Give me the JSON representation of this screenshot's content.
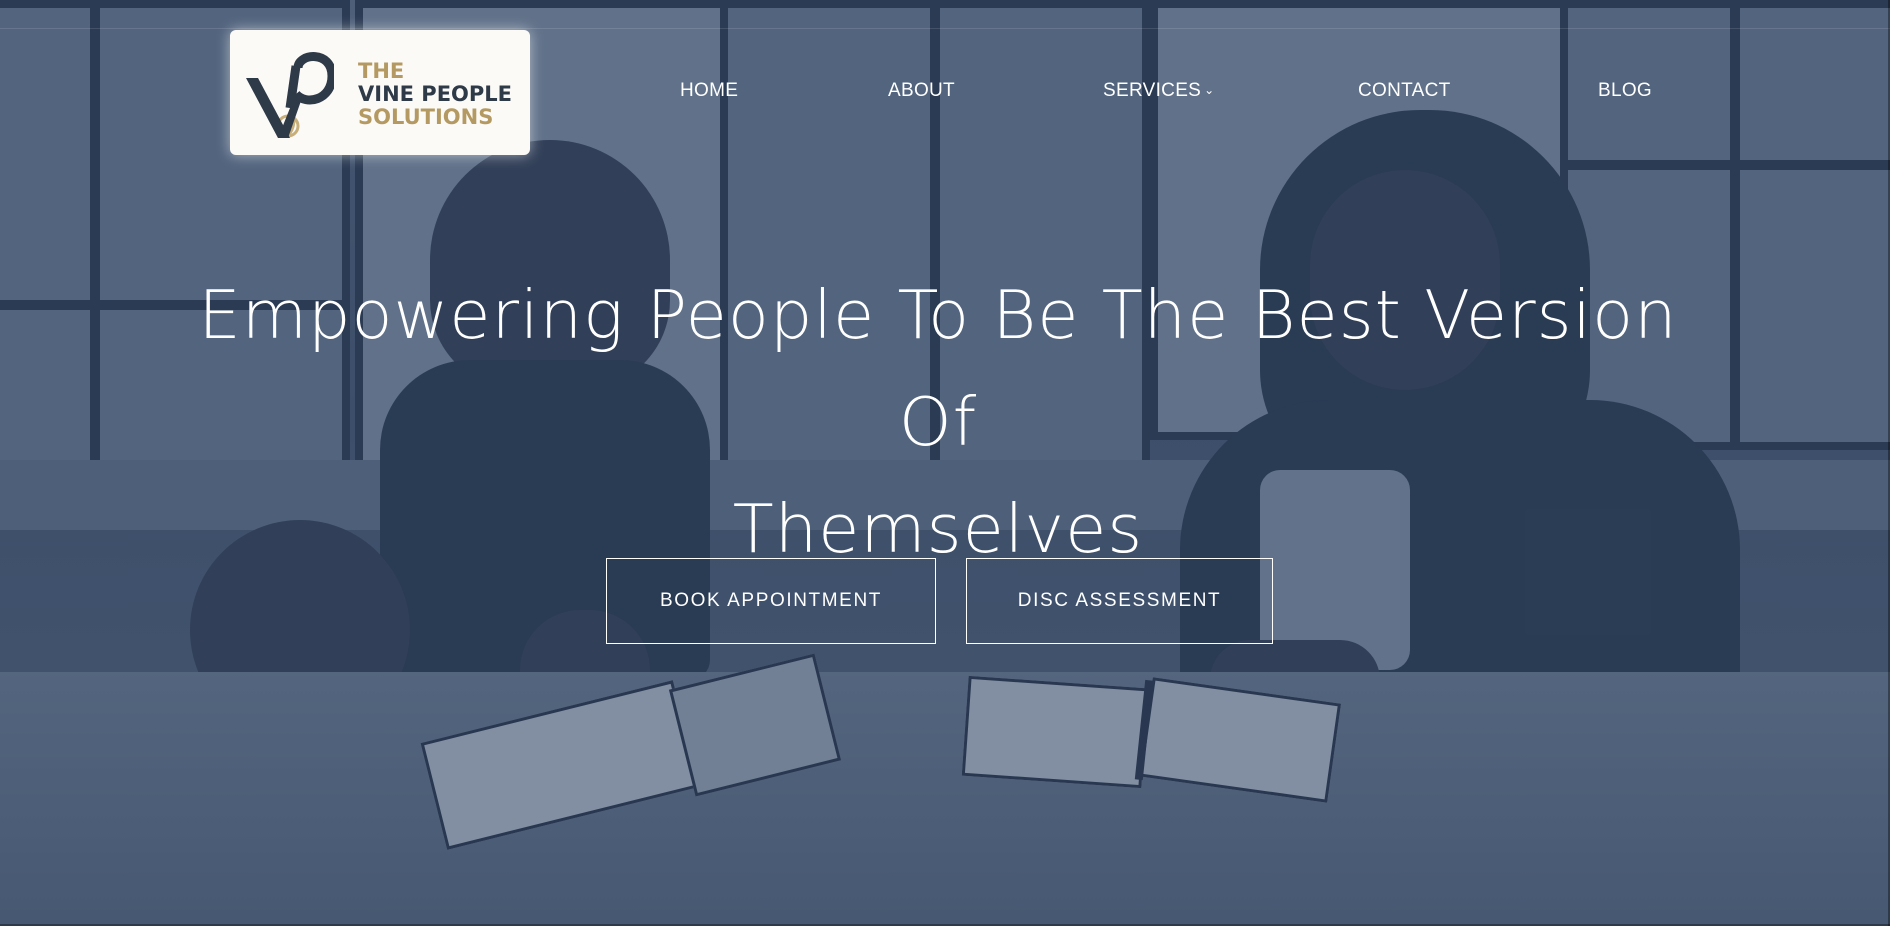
{
  "brand": {
    "logo_line1": "THE",
    "logo_line2": "VINE PEOPLE",
    "logo_line3": "SOLUTIONS",
    "logo_mark_letters": "VP",
    "gold": "#b49a62",
    "dark": "#2f3a48"
  },
  "nav": {
    "items": [
      {
        "label": "HOME"
      },
      {
        "label": "ABOUT"
      },
      {
        "label": "SERVICES",
        "has_dropdown": true,
        "dropdown_icon": "chevron-down-icon"
      },
      {
        "label": "CONTACT"
      },
      {
        "label": "BLOG"
      }
    ]
  },
  "hero": {
    "headline_line1": "Empowering People To Be The Best Version Of",
    "headline_line2": "Themselves",
    "overlay_color": "#263a58",
    "buttons": {
      "book_label": "BOOK APPOINTMENT",
      "disc_label": "DISC ASSESSMENT"
    }
  }
}
